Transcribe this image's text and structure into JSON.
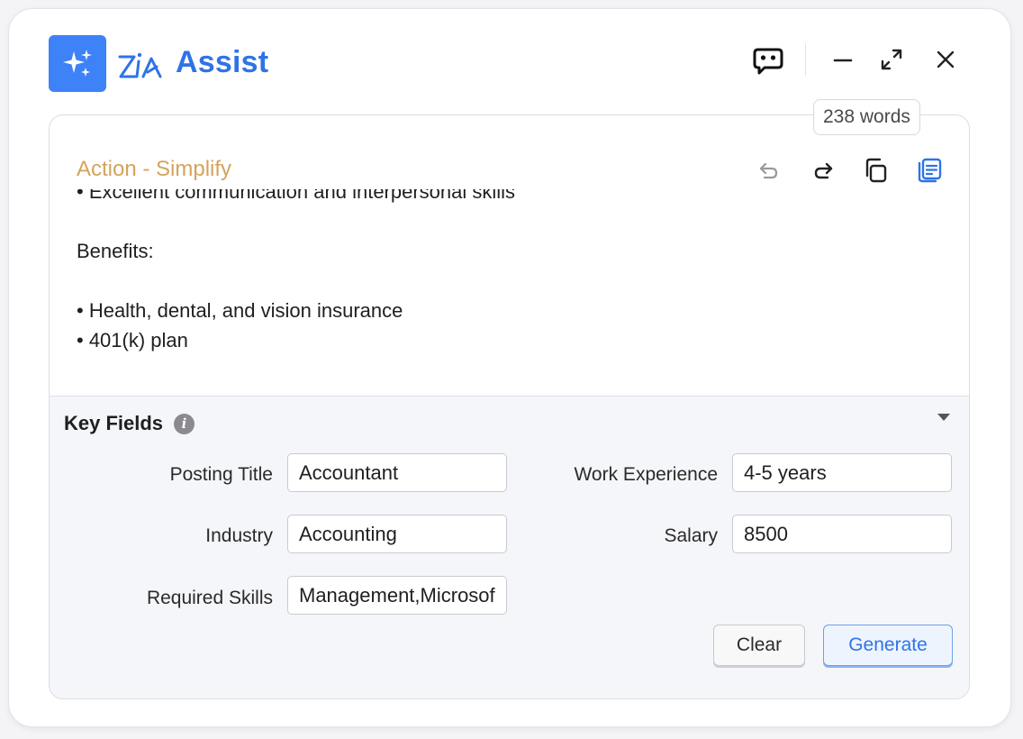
{
  "header": {
    "title": "Assist",
    "app_icon": "sparkles-icon",
    "logo": "zia-logo-icon",
    "controls": [
      "chat-bot-icon",
      "minimize-icon",
      "expand-icon",
      "close-icon"
    ]
  },
  "card": {
    "word_count": "238 words",
    "action_label": "Action - Simplify",
    "toolbar": [
      "undo-icon",
      "redo-icon",
      "copy-icon",
      "document-icon"
    ],
    "content_lines": [
      "• Excellent communication and interpersonal skills",
      "",
      "Benefits:",
      "",
      "• Health, dental, and vision insurance",
      "• 401(k) plan"
    ]
  },
  "key_fields": {
    "title": "Key Fields",
    "posting_title": {
      "label": "Posting Title",
      "value": "Accountant"
    },
    "industry": {
      "label": "Industry",
      "value": "Accounting"
    },
    "required_skills": {
      "label": "Required Skills",
      "value": "Management,Microsoft"
    },
    "work_experience": {
      "label": "Work Experience",
      "value": "4-5 years"
    },
    "salary": {
      "label": "Salary",
      "value": "8500"
    },
    "clear_label": "Clear",
    "generate_label": "Generate"
  },
  "colors": {
    "brand_blue": "#3e82f7",
    "title_blue": "#2f73e6",
    "action_label": "#d4a35d"
  }
}
